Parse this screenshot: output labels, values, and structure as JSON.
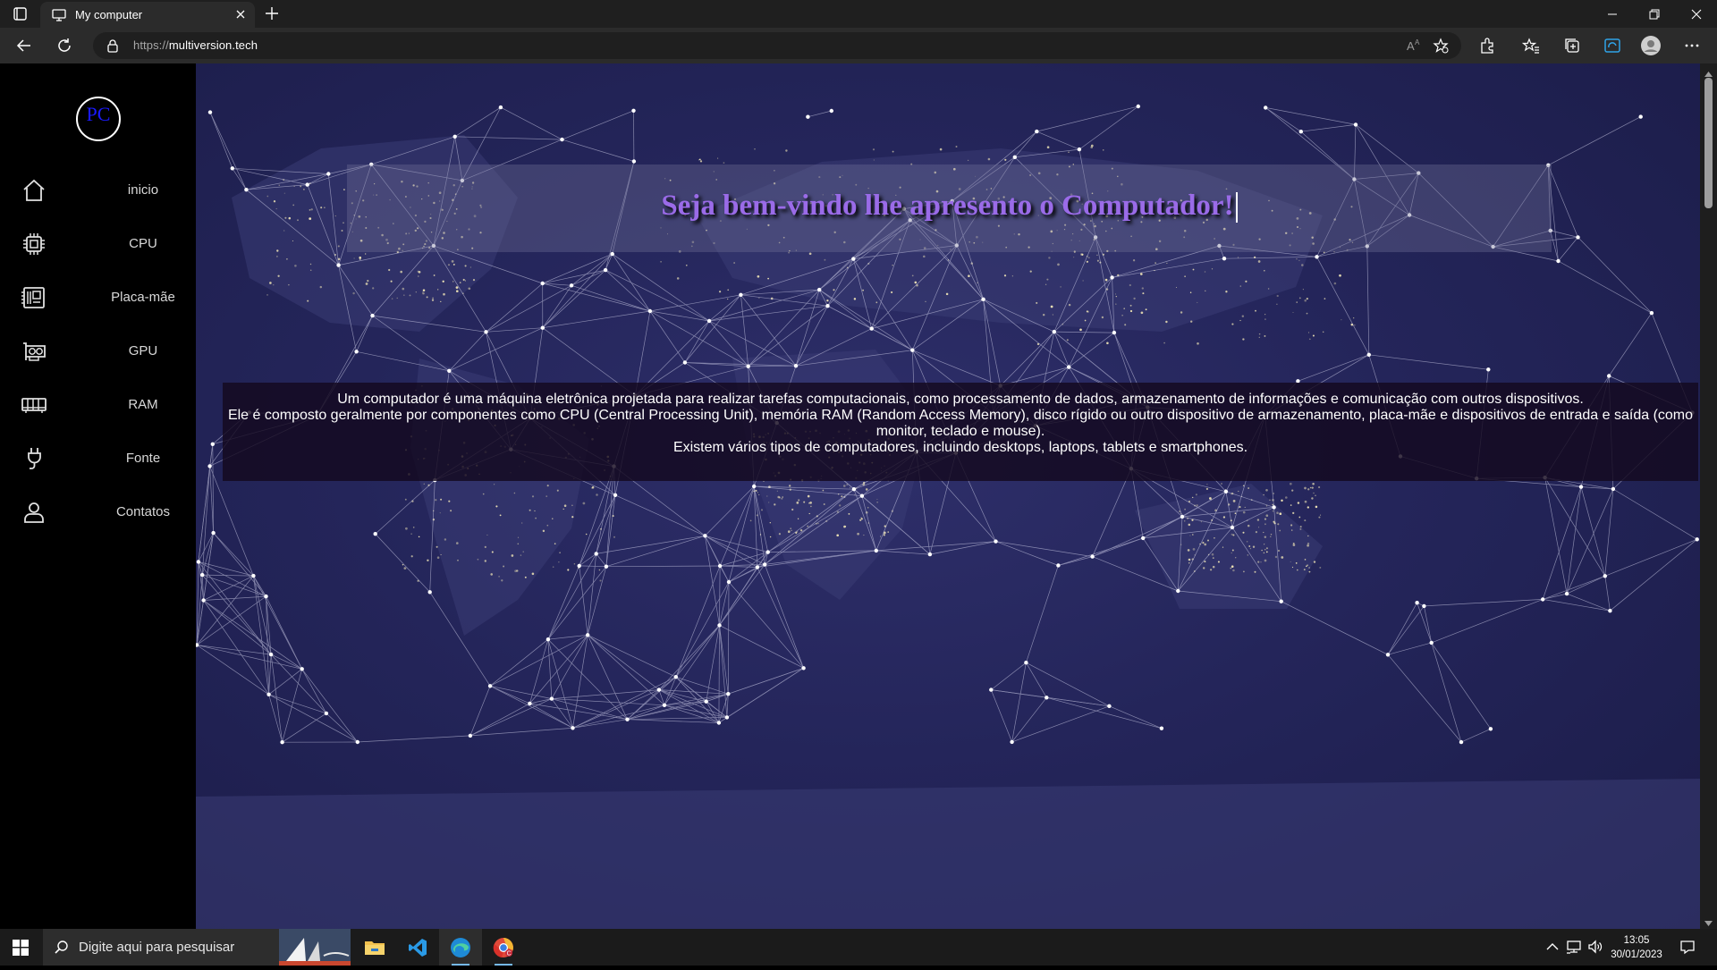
{
  "browser": {
    "tab_title": "My computer",
    "url_protocol": "https://",
    "url_host": "multiversion.tech"
  },
  "sidebar": {
    "logo_text": "PC",
    "items": [
      {
        "label": "inicio",
        "icon": "home-icon"
      },
      {
        "label": "CPU",
        "icon": "cpu-icon"
      },
      {
        "label": "Placa-mãe",
        "icon": "motherboard-icon"
      },
      {
        "label": "GPU",
        "icon": "gpu-icon"
      },
      {
        "label": "RAM",
        "icon": "ram-icon"
      },
      {
        "label": "Fonte",
        "icon": "power-plug-icon"
      },
      {
        "label": "Contatos",
        "icon": "user-icon"
      }
    ]
  },
  "main": {
    "welcome_title": "Seja bem-vindo lhe apresento o Computador!",
    "intro_lines": [
      "Um computador é uma máquina eletrônica projetada para realizar tarefas computacionais, como processamento de dados, armazenamento de informações e comunicação com outros dispositivos.",
      "Ele é composto geralmente por componentes como CPU (Central Processing Unit), memória RAM (Random Access Memory), disco rígido ou outro dispositivo de armazenamento, placa-mãe e dispositivos de entrada e saída (como monitor, teclado e mouse).",
      "Existem vários tipos de computadores, incluindo desktops, laptops, tablets e smartphones."
    ]
  },
  "taskbar": {
    "search_placeholder": "Digite aqui para pesquisar",
    "time": "13:05",
    "date": "30/01/2023"
  },
  "colors": {
    "title_purple": "#9a6be8",
    "page_bg": "#24255a",
    "logo_blue": "#1a1aff"
  }
}
